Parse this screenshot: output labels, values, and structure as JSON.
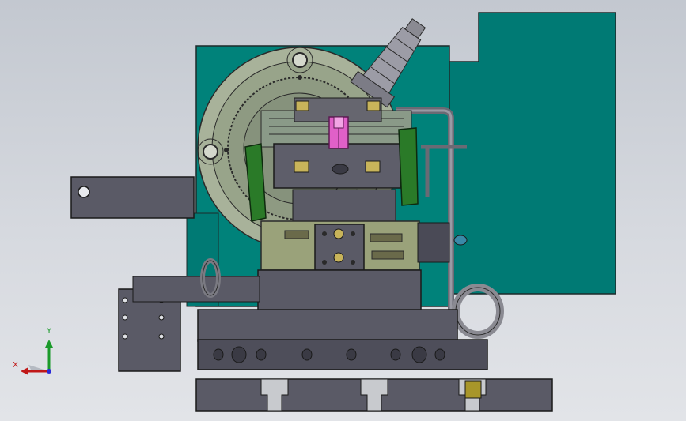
{
  "viewport": {
    "background_top": "#c3c8d0",
    "background_bottom": "#e2e4e8"
  },
  "triad": {
    "x_label": "X",
    "y_label": "Y",
    "x_color": "#c01818",
    "y_color": "#1a9a2a",
    "z_color": "#2a2ad8"
  },
  "model": {
    "panel_color": "#007a74",
    "body_color": "#5a5a66",
    "highlight_color": "#e060c8",
    "clamp_color": "#2a7a28",
    "gear_color": "#96a48a"
  }
}
